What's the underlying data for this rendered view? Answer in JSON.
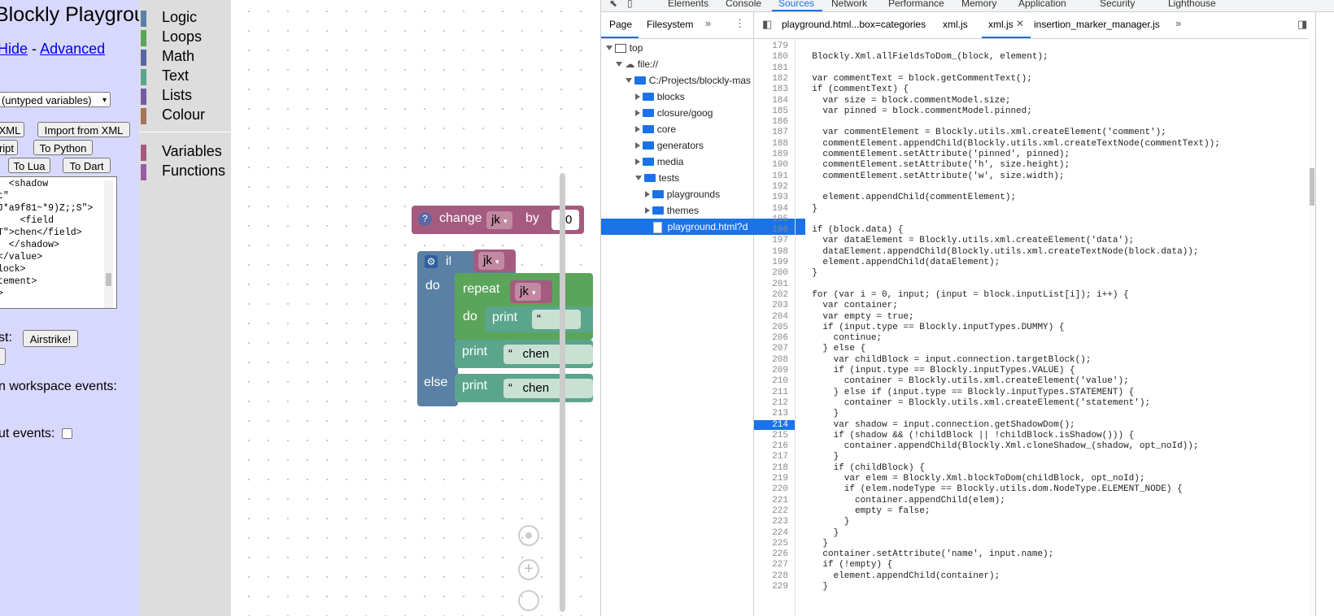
{
  "playground": {
    "title": "Blockly Playground",
    "link_hide": "Hide",
    "link_separator": "-",
    "link_advanced": "Advanced",
    "toolbox_select": "(untyped variables)",
    "btn_export_xml": "XML",
    "btn_import_xml": "Import from XML",
    "btn_to_js": "ript",
    "btn_to_python": "To Python",
    "btn_to_lua": "To Lua",
    "btn_to_dart": "To Dart",
    "xml_lines": [
      "  <shadow",
      "t\"",
      "J*a9f81~*9)Z;;S\">",
      "    <field",
      "T\">chen</field>",
      "  </shadow>",
      "</value>",
      "lock>",
      "tement>",
      ">"
    ],
    "stress_label": "st:",
    "btn_airstrike": "Airstrike!",
    "log_events_label": "n workspace events:",
    "log_flyout_label": "ut events:"
  },
  "toolbox": {
    "categories": [
      {
        "label": "Logic",
        "color": "#5b80a5"
      },
      {
        "label": "Loops",
        "color": "#5ba55b"
      },
      {
        "label": "Math",
        "color": "#5b67a5"
      },
      {
        "label": "Text",
        "color": "#5ba58c"
      },
      {
        "label": "Lists",
        "color": "#745ba5"
      },
      {
        "label": "Colour",
        "color": "#a5745b"
      },
      {
        "label": "Variables",
        "color": "#a55b80"
      },
      {
        "label": "Functions",
        "color": "#995ba5"
      }
    ]
  },
  "blocks": {
    "change_label": "change",
    "change_var": "jk",
    "change_by": "by",
    "change_value": "10",
    "if_label": "if",
    "if_var": "jk",
    "do_label": "do",
    "repeat_label": "repeat",
    "repeat_var": "jk",
    "repeat_do": "do",
    "print_label": "print",
    "print_value": "chen",
    "else_label": "else",
    "quote": "“"
  },
  "devtools": {
    "tabs": [
      "Elements",
      "Console",
      "Sources",
      "Network",
      "Performance",
      "Memory",
      "Application",
      "Security",
      "Lighthouse"
    ],
    "active_tab": "Sources",
    "nav_tabs": [
      "Page",
      "Filesystem"
    ],
    "tree": {
      "top": "top",
      "origin": "file://",
      "project": "C:/Projects/blockly-mas",
      "folders": [
        "blocks",
        "closure/goog",
        "core",
        "generators",
        "media",
        "tests",
        "playgrounds",
        "themes"
      ],
      "file": "playground.html?d"
    },
    "editor_tabs": [
      "playground.html...box=categories",
      "xml.js",
      "xml.js",
      "insertion_marker_manager.js"
    ],
    "breakpoint_line": "214",
    "code_lines": [
      {
        "n": "179",
        "t": ""
      },
      {
        "n": "180",
        "t": "  Blockly.Xml.allFieldsToDom_(block, element);"
      },
      {
        "n": "181",
        "t": ""
      },
      {
        "n": "182",
        "t": "  var commentText = block.getCommentText();"
      },
      {
        "n": "183",
        "t": "  if (commentText) {"
      },
      {
        "n": "184",
        "t": "    var size = block.commentModel.size;"
      },
      {
        "n": "185",
        "t": "    var pinned = block.commentModel.pinned;"
      },
      {
        "n": "186",
        "t": ""
      },
      {
        "n": "187",
        "t": "    var commentElement = Blockly.utils.xml.createElement('comment');"
      },
      {
        "n": "188",
        "t": "    commentElement.appendChild(Blockly.utils.xml.createTextNode(commentText));"
      },
      {
        "n": "189",
        "t": "    commentElement.setAttribute('pinned', pinned);"
      },
      {
        "n": "190",
        "t": "    commentElement.setAttribute('h', size.height);"
      },
      {
        "n": "191",
        "t": "    commentElement.setAttribute('w', size.width);"
      },
      {
        "n": "192",
        "t": ""
      },
      {
        "n": "193",
        "t": "    element.appendChild(commentElement);"
      },
      {
        "n": "194",
        "t": "  }"
      },
      {
        "n": "195",
        "t": ""
      },
      {
        "n": "196",
        "t": "  if (block.data) {"
      },
      {
        "n": "197",
        "t": "    var dataElement = Blockly.utils.xml.createElement('data');"
      },
      {
        "n": "198",
        "t": "    dataElement.appendChild(Blockly.utils.xml.createTextNode(block.data));"
      },
      {
        "n": "199",
        "t": "    element.appendChild(dataElement);"
      },
      {
        "n": "200",
        "t": "  }"
      },
      {
        "n": "201",
        "t": ""
      },
      {
        "n": "202",
        "t": "  for (var i = 0, input; (input = block.inputList[i]); i++) {"
      },
      {
        "n": "203",
        "t": "    var container;"
      },
      {
        "n": "204",
        "t": "    var empty = true;"
      },
      {
        "n": "205",
        "t": "    if (input.type == Blockly.inputTypes.DUMMY) {"
      },
      {
        "n": "206",
        "t": "      continue;"
      },
      {
        "n": "207",
        "t": "    } else {"
      },
      {
        "n": "208",
        "t": "      var childBlock = input.connection.targetBlock();"
      },
      {
        "n": "209",
        "t": "      if (input.type == Blockly.inputTypes.VALUE) {"
      },
      {
        "n": "210",
        "t": "        container = Blockly.utils.xml.createElement('value');"
      },
      {
        "n": "211",
        "t": "      } else if (input.type == Blockly.inputTypes.STATEMENT) {"
      },
      {
        "n": "212",
        "t": "        container = Blockly.utils.xml.createElement('statement');"
      },
      {
        "n": "213",
        "t": "      }"
      },
      {
        "n": "214",
        "t": "      var shadow = input.connection.getShadowDom();"
      },
      {
        "n": "215",
        "t": "      if (shadow && (!childBlock || !childBlock.isShadow())) {"
      },
      {
        "n": "216",
        "t": "        container.appendChild(Blockly.Xml.cloneShadow_(shadow, opt_noId));"
      },
      {
        "n": "217",
        "t": "      }"
      },
      {
        "n": "218",
        "t": "      if (childBlock) {"
      },
      {
        "n": "219",
        "t": "        var elem = Blockly.Xml.blockToDom(childBlock, opt_noId);"
      },
      {
        "n": "220",
        "t": "        if (elem.nodeType == Blockly.utils.dom.NodeType.ELEMENT_NODE) {"
      },
      {
        "n": "221",
        "t": "          container.appendChild(elem);"
      },
      {
        "n": "222",
        "t": "          empty = false;"
      },
      {
        "n": "223",
        "t": "        }"
      },
      {
        "n": "224",
        "t": "      }"
      },
      {
        "n": "225",
        "t": "    }"
      },
      {
        "n": "226",
        "t": "    container.setAttribute('name', input.name);"
      },
      {
        "n": "227",
        "t": "    if (!empty) {"
      },
      {
        "n": "228",
        "t": "      element.appendChild(container);"
      },
      {
        "n": "229",
        "t": "    }"
      }
    ]
  }
}
